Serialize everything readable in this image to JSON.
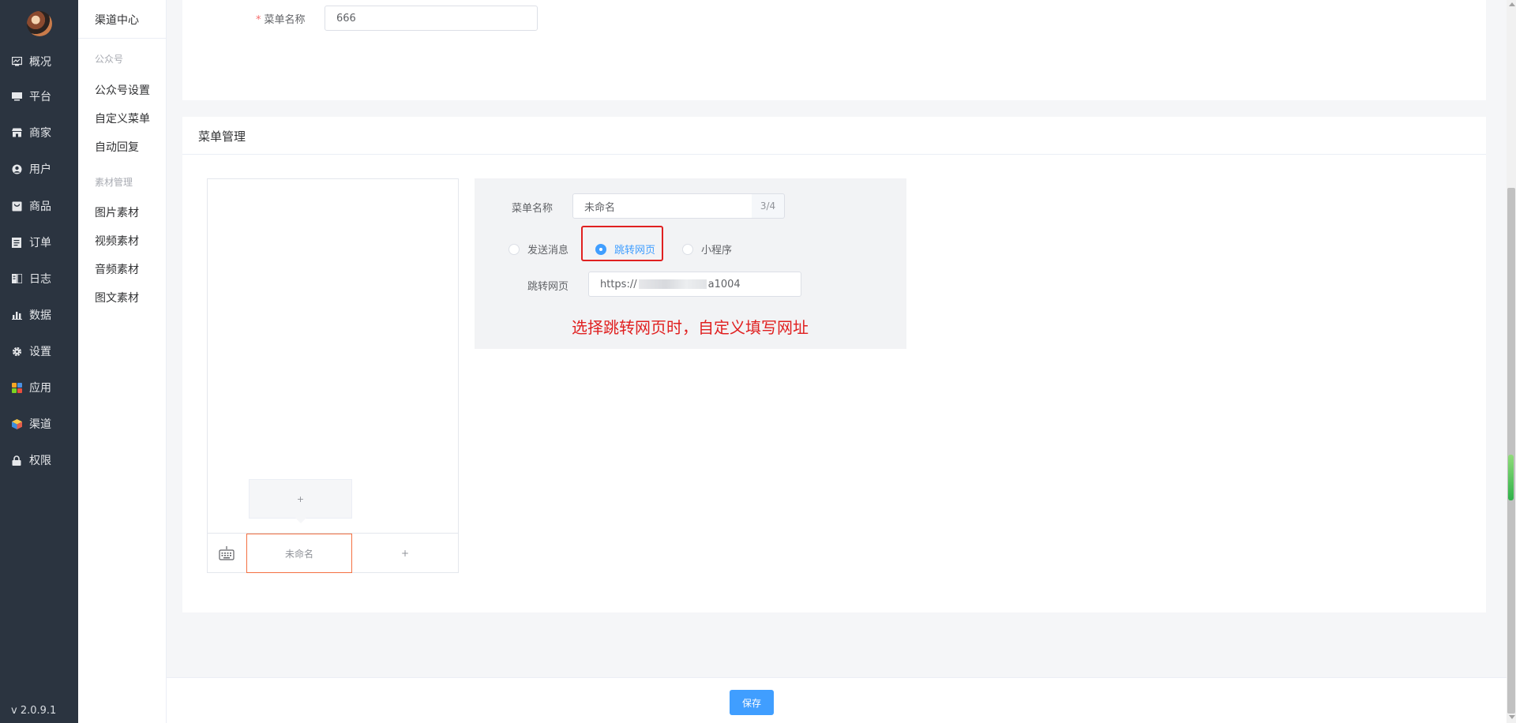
{
  "nav": {
    "items": [
      {
        "label": "概况",
        "icon": "dashboard-icon"
      },
      {
        "label": "平台",
        "icon": "monitor-icon"
      },
      {
        "label": "商家",
        "icon": "store-icon"
      },
      {
        "label": "用户",
        "icon": "user-icon"
      },
      {
        "label": "商品",
        "icon": "bag-icon"
      },
      {
        "label": "订单",
        "icon": "order-icon"
      },
      {
        "label": "日志",
        "icon": "log-icon"
      },
      {
        "label": "数据",
        "icon": "bar-chart-icon"
      },
      {
        "label": "设置",
        "icon": "gear-icon"
      },
      {
        "label": "应用",
        "icon": "apps-icon"
      },
      {
        "label": "渠道",
        "icon": "cube-icon"
      },
      {
        "label": "权限",
        "icon": "lock-icon"
      }
    ],
    "version": "v 2.0.9.1"
  },
  "submenu": {
    "title": "渠道中心",
    "group1": "公众号",
    "group1_items": [
      "公众号设置",
      "自定义菜单",
      "自动回复"
    ],
    "group2": "素材管理",
    "group2_items": [
      "图片素材",
      "视频素材",
      "音频素材",
      "图文素材"
    ]
  },
  "basic": {
    "name_label": "菜单名称",
    "name_value": "666"
  },
  "menu_manage": {
    "title": "菜单管理",
    "preview": {
      "sub_add": "+",
      "tab_active": "未命名",
      "tab_add": "+"
    },
    "config": {
      "name_label": "菜单名称",
      "name_value": "未命名",
      "name_count": "3/4",
      "radio_send": "发送消息",
      "radio_link": "跳转网页",
      "radio_mini": "小程序",
      "url_label": "跳转网页",
      "url_prefix": "https://",
      "url_suffix": "a1004"
    },
    "annotation": "选择跳转网页时，自定义填写网址"
  },
  "footer": {
    "save_label": "保存"
  },
  "colors": {
    "nav_bg": "#2b3440",
    "primary": "#409eff",
    "highlight": "#e02020",
    "tab_active_border": "#f47042"
  }
}
